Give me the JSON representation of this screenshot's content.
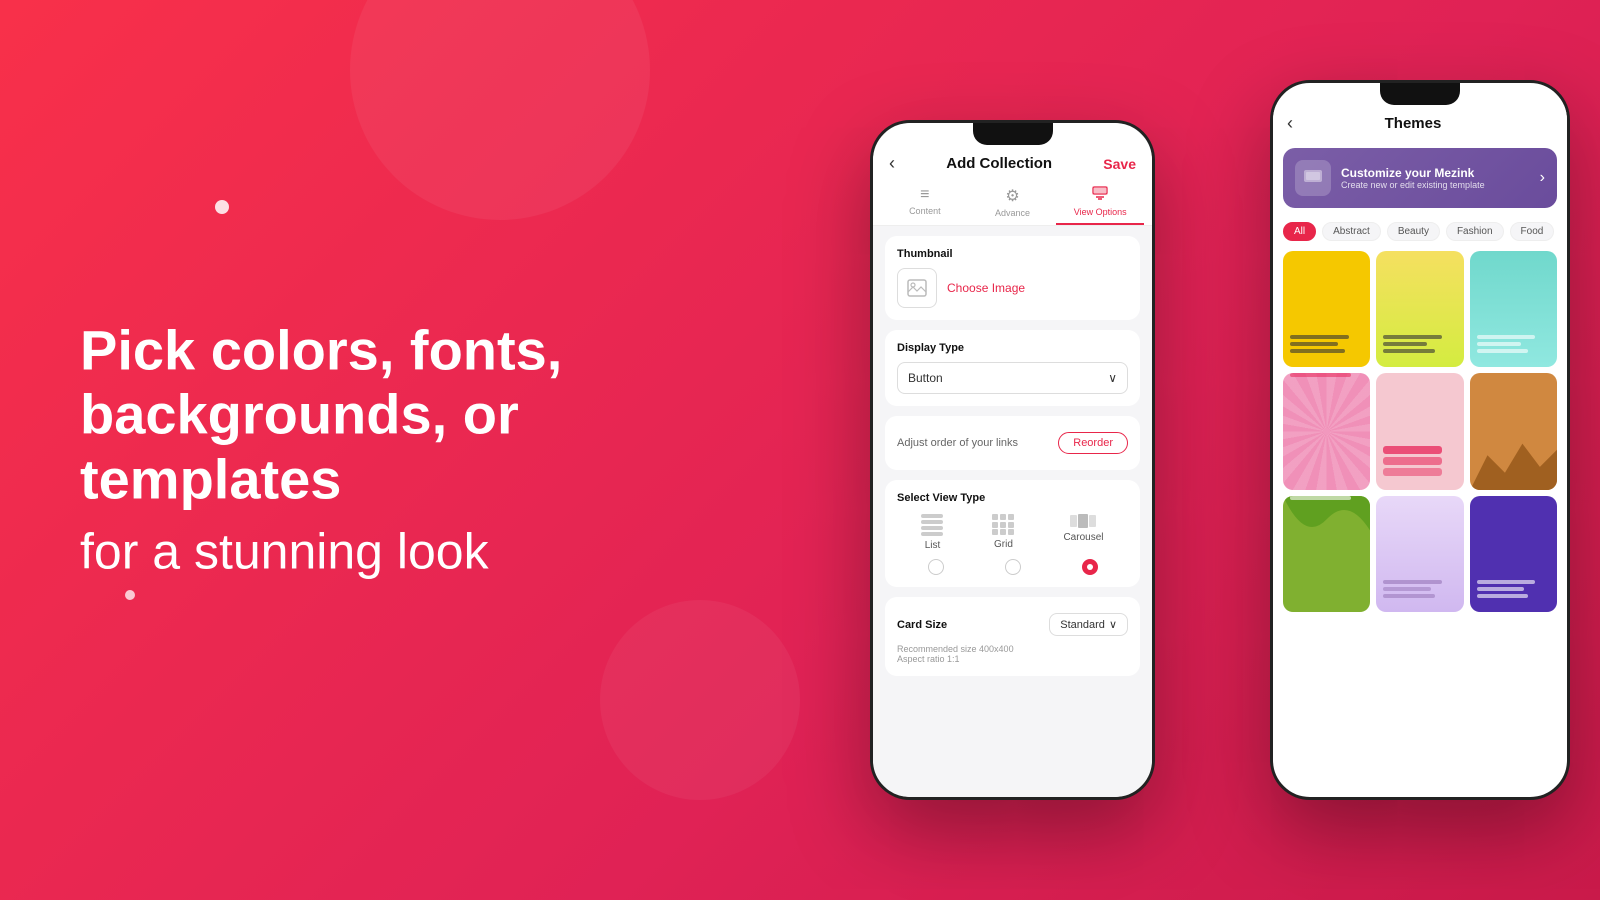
{
  "background": {
    "gradient": "linear-gradient(135deg, #f8304a 0%, #e02255 60%, #c91a4a 100%)"
  },
  "left_text": {
    "line1": "Pick colors, fonts,",
    "line2": "backgrounds, or templates",
    "line3": "for a stunning look"
  },
  "phone1": {
    "title": "Add Collection",
    "save_label": "Save",
    "back_icon": "‹",
    "tabs": [
      {
        "id": "content",
        "label": "Content",
        "icon": "≡"
      },
      {
        "id": "advance",
        "label": "Advance",
        "icon": "⚙"
      },
      {
        "id": "view-options",
        "label": "View Options",
        "icon": "🖼"
      }
    ],
    "active_tab": "view-options",
    "sections": {
      "thumbnail": {
        "label": "Thumbnail",
        "choose_image": "Choose Image"
      },
      "display_type": {
        "label": "Display Type",
        "value": "Button",
        "chevron": "∨"
      },
      "reorder": {
        "text": "Adjust order of your links",
        "button_label": "Reorder"
      },
      "view_type": {
        "label": "Select View Type",
        "options": [
          {
            "id": "list",
            "label": "List"
          },
          {
            "id": "grid",
            "label": "Grid"
          },
          {
            "id": "carousel",
            "label": "Carousel"
          }
        ],
        "selected": "carousel"
      },
      "card_size": {
        "label": "Card Size",
        "value": "Standard",
        "chevron": "∨",
        "recommend": "Recommended size 400x400",
        "ratio": "Aspect ratio 1:1"
      }
    }
  },
  "phone2": {
    "title": "Themes",
    "back_icon": "‹",
    "banner": {
      "title": "Customize your Mezink",
      "subtitle": "Create new or edit existing template",
      "arrow": "›"
    },
    "filters": [
      "All",
      "Abstract",
      "Beauty",
      "Fashion",
      "Food"
    ],
    "active_filter": "All",
    "themes": [
      {
        "id": "yellow-solid",
        "style": "yellow"
      },
      {
        "id": "yellow-green",
        "style": "yellow-green"
      },
      {
        "id": "cyan",
        "style": "cyan"
      },
      {
        "id": "pink-rays",
        "style": "pink-rays"
      },
      {
        "id": "red-bars",
        "style": "red-bars"
      },
      {
        "id": "brown-mountain",
        "style": "brown-mountain"
      },
      {
        "id": "green-waves",
        "style": "green-waves"
      },
      {
        "id": "lavender",
        "style": "lavender"
      },
      {
        "id": "purple",
        "style": "purple"
      }
    ]
  }
}
